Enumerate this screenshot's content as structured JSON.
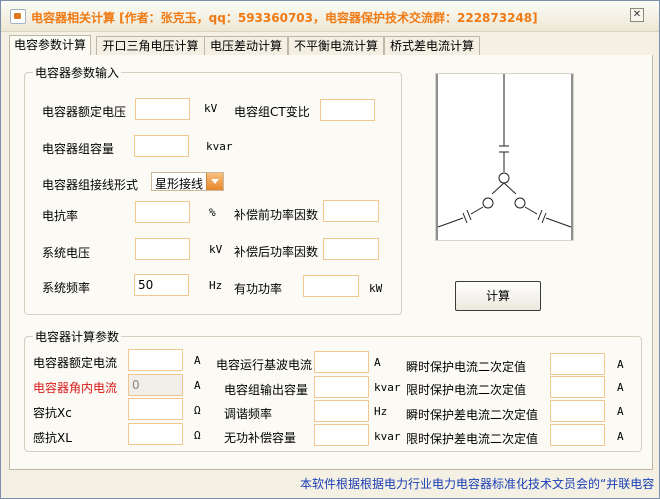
{
  "window": {
    "title": "电容器相关计算 [作者：张克玉，qq：593360703，电容器保护技术交流群：222873248]"
  },
  "tabs": [
    {
      "label": "电容参数计算",
      "active": true
    },
    {
      "label": "开口三角电压计算",
      "active": false
    },
    {
      "label": "电压差动计算",
      "active": false
    },
    {
      "label": "不平衡电流计算",
      "active": false
    },
    {
      "label": "桥式差电流计算",
      "active": false
    }
  ],
  "input_group": {
    "title": "电容器参数输入",
    "rated_voltage": {
      "label": "电容器额定电压",
      "value": "",
      "unit": "kV"
    },
    "ct_ratio": {
      "label": "电容组CT变比",
      "value": ""
    },
    "capacity": {
      "label": "电容器组容量",
      "value": "",
      "unit": "kvar"
    },
    "wiring": {
      "label": "电容器组接线形式",
      "selected": "星形接线"
    },
    "reactance_rate": {
      "label": "电抗率",
      "value": "",
      "unit": "%"
    },
    "pf_before": {
      "label": "补偿前功率因数",
      "value": ""
    },
    "system_voltage": {
      "label": "系统电压",
      "value": "",
      "unit": "kV"
    },
    "pf_after": {
      "label": "补偿后功率因数",
      "value": ""
    },
    "system_freq": {
      "label": "系统频率",
      "value": "50",
      "unit": "Hz"
    },
    "active_power": {
      "label": "有功功率",
      "value": "",
      "unit": "kW"
    }
  },
  "calc_button": {
    "label": "计算"
  },
  "output_group": {
    "title": "电容器计算参数",
    "rated_current": {
      "label": "电容器额定电流",
      "value": "",
      "unit": "A"
    },
    "angle_current": {
      "label": "电容器角内电流",
      "value": "0",
      "unit": "A",
      "color": "#d81a1a"
    },
    "xc": {
      "label": "容抗Xc",
      "value": "",
      "unit": "Ω"
    },
    "xl": {
      "label": "感抗XL",
      "value": "",
      "unit": "Ω"
    },
    "fundamental_current": {
      "label": "电容运行基波电流",
      "value": "",
      "unit": "A"
    },
    "output_capacity": {
      "label": "电容组输出容量",
      "value": "",
      "unit": "kvar"
    },
    "tuning_freq": {
      "label": "调谐频率",
      "value": "",
      "unit": "Hz"
    },
    "reactive_comp": {
      "label": "无功补偿容量",
      "value": "",
      "unit": "kvar"
    },
    "inst_current_setting": {
      "label": "瞬时保护电流二次定值",
      "value": "",
      "unit": "A"
    },
    "timed_current_setting": {
      "label": "限时保护电流二次定值",
      "value": "",
      "unit": "A"
    },
    "inst_diff_setting": {
      "label": "瞬时保护差电流二次定值",
      "value": "",
      "unit": "A"
    },
    "timed_diff_setting": {
      "label": "限时保护差电流二次定值",
      "value": "",
      "unit": "A"
    }
  },
  "status": {
    "text": "本软件根据根据电力行业电力电容器标准化技术文员会的“并联电容"
  },
  "colors": {
    "title": "#f07a14",
    "status": "#1b3fb5",
    "input_border": "#f0c890",
    "accent": "#e8862c"
  }
}
